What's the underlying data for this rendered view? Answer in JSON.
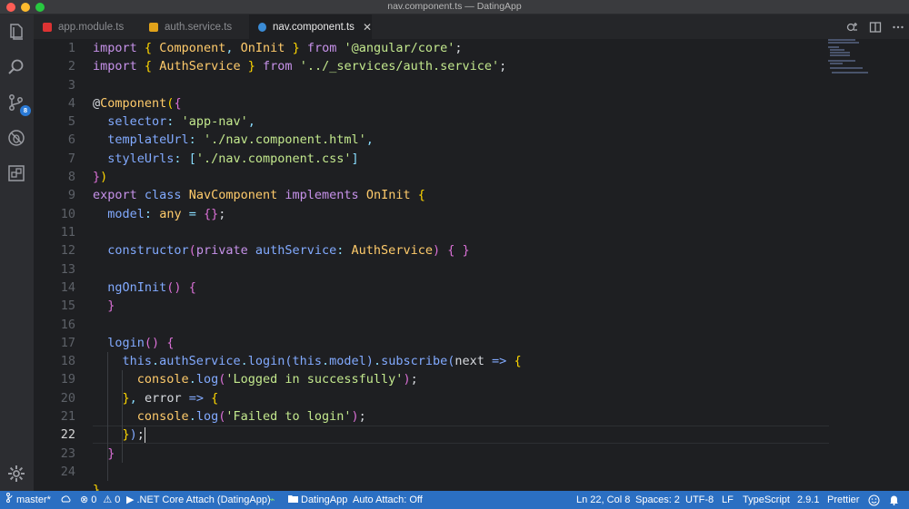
{
  "window": {
    "title": "nav.component.ts — DatingApp"
  },
  "activity": {
    "scm_badge": "8"
  },
  "tabs": [
    {
      "label": "app.module.ts",
      "icon": "angular-icon",
      "active": false
    },
    {
      "label": "auth.service.ts",
      "icon": "angular-icon",
      "active": false
    },
    {
      "label": "nav.component.ts",
      "icon": "typescript-icon",
      "active": true,
      "close": "✕"
    }
  ],
  "editor": {
    "current_line": 22,
    "line_numbers": [
      "1",
      "2",
      "3",
      "4",
      "5",
      "6",
      "7",
      "8",
      "9",
      "10",
      "11",
      "12",
      "13",
      "14",
      "15",
      "16",
      "17",
      "18",
      "19",
      "20",
      "21",
      "22",
      "23",
      "24"
    ]
  },
  "status": {
    "branch": "master*",
    "errors": "0",
    "warnings": "0",
    "debug": ".NET Core Attach (DatingApp)",
    "folder": "DatingApp",
    "auto_attach": "Auto Attach: Off",
    "position": "Ln 22, Col 8",
    "spaces": "Spaces: 2",
    "encoding": "UTF-8",
    "eol": "LF",
    "language": "TypeScript",
    "version": "2.9.1",
    "formatter": "Prettier"
  },
  "colors": {
    "status_bar": "#2b6fc2",
    "editor_bg": "#1e1f22",
    "badge": "#2a7ad6"
  }
}
